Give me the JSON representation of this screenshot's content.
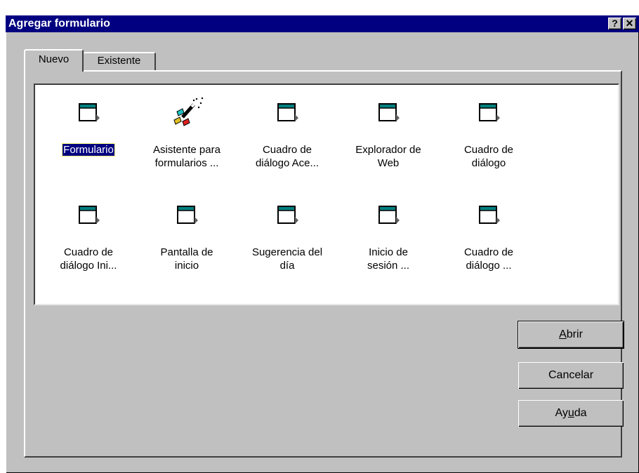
{
  "window": {
    "title": "Agregar formulario",
    "help_button": "?",
    "close_button": "✕"
  },
  "tabs": [
    {
      "label": "Nuevo",
      "active": true
    },
    {
      "label": "Existente",
      "active": false
    }
  ],
  "items": [
    {
      "label_line1": "Formulario",
      "label_line2": "",
      "icon": "form-icon",
      "selected": true
    },
    {
      "label_line1": "Asistente para",
      "label_line2": "formularios ...",
      "icon": "wizard-wand-icon",
      "selected": false
    },
    {
      "label_line1": "Cuadro de",
      "label_line2": "diálogo Ace...",
      "icon": "form-icon",
      "selected": false
    },
    {
      "label_line1": "Explorador de",
      "label_line2": "Web",
      "icon": "form-icon",
      "selected": false
    },
    {
      "label_line1": "Cuadro de",
      "label_line2": "diálogo",
      "icon": "form-icon",
      "selected": false
    },
    {
      "label_line1": "Cuadro de",
      "label_line2": "diálogo Ini...",
      "icon": "form-icon",
      "selected": false
    },
    {
      "label_line1": "Pantalla de",
      "label_line2": "inicio",
      "icon": "form-icon",
      "selected": false
    },
    {
      "label_line1": "Sugerencia del",
      "label_line2": "día",
      "icon": "form-icon",
      "selected": false
    },
    {
      "label_line1": "Inicio de",
      "label_line2": "sesión ...",
      "icon": "form-icon",
      "selected": false
    },
    {
      "label_line1": "Cuadro de",
      "label_line2": "diálogo ...",
      "icon": "form-icon",
      "selected": false
    }
  ],
  "buttons": {
    "open": {
      "label": "Abrir",
      "mnemonic": "A"
    },
    "cancel": {
      "label": "Cancelar"
    },
    "help": {
      "label": "Ayuda",
      "mnemonic": "u"
    }
  },
  "colors": {
    "titlebar": "#000080",
    "face": "#c0c0c0",
    "selection": "#000080"
  }
}
